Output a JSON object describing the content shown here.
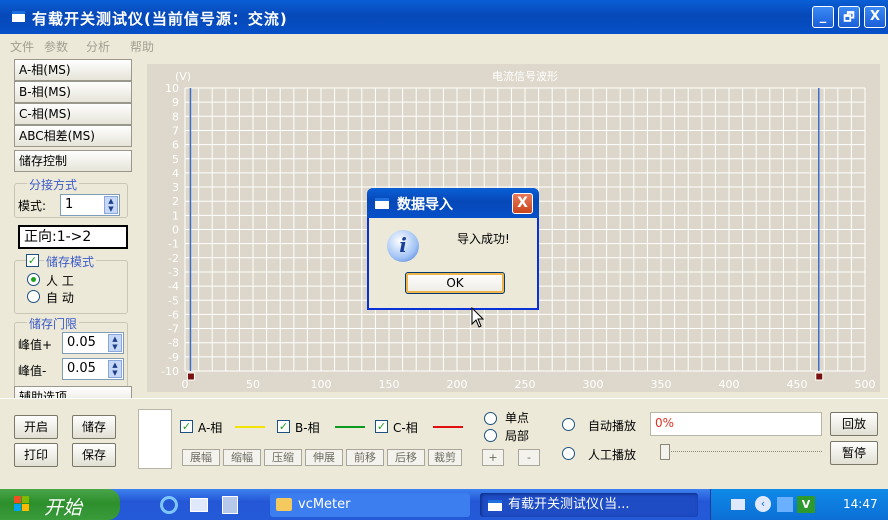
{
  "window": {
    "title": "有载开关测试仪(当前信号源：交流)"
  },
  "titlebar_buttons": {
    "minimize": "_",
    "restore": "🗗",
    "close": "X"
  },
  "menu": [
    "文件",
    "参数",
    "分析",
    "帮助"
  ],
  "sidebar": {
    "nav": [
      "A-相(MS)",
      "B-相(MS)",
      "C-相(MS)",
      "ABC相差(MS)",
      "储存控制"
    ],
    "split_group": {
      "legend": "分接方式",
      "mode_label": "模式:",
      "mode_value": "1",
      "direction": "正向:1->2"
    },
    "store_group": {
      "checkbox_label": "储存模式",
      "checked": true,
      "options": [
        "人 工",
        "自 动"
      ],
      "selected": 0
    },
    "threshold_group": {
      "legend": "储存门限",
      "peak_plus_label": "峰值+",
      "peak_plus_value": "0.05",
      "peak_minus_label": "峰值-",
      "peak_minus_value": "0.05"
    },
    "aux": "辅助选项"
  },
  "actions": {
    "open": "开启",
    "store": "储存",
    "print": "打印",
    "save": "保存"
  },
  "chart_data": {
    "type": "line",
    "title": "电流信号波形",
    "ylabel": "(V)",
    "xlim": [
      0,
      500
    ],
    "ylim": [
      -10,
      10
    ],
    "xticks": [
      "0",
      "50",
      "100",
      "150",
      "200",
      "250",
      "300",
      "350",
      "400",
      "450",
      "500"
    ],
    "yticks": [
      "10",
      "9",
      "8",
      "7",
      "6",
      "5",
      "4",
      "3",
      "2",
      "1",
      "0",
      "-1",
      "-2",
      "-3",
      "-4",
      "-5",
      "-6",
      "-7",
      "-8",
      "-9",
      "-10"
    ],
    "grid": true,
    "cursors": [
      4,
      466
    ]
  },
  "phases": [
    {
      "label": "A-相",
      "checked": true,
      "color": "#f2e300"
    },
    {
      "label": "B-相",
      "checked": true,
      "color": "#0a9a1e"
    },
    {
      "label": "C-相",
      "checked": true,
      "color": "#e01010"
    }
  ],
  "waveform_buttons": [
    "展幅",
    "缩幅",
    "压缩",
    "伸展",
    "前移",
    "后移",
    "裁剪"
  ],
  "view_mode": {
    "options": [
      "单点",
      "局部"
    ],
    "plus": "+",
    "minus": "-"
  },
  "playback": {
    "auto_label": "自动播放",
    "percent": "0%",
    "replay": "回放",
    "manual_label": "人工播放",
    "pause": "暂停"
  },
  "dialog": {
    "title": "数据导入",
    "message": "导入成功!",
    "ok": "OK",
    "close": "X"
  },
  "taskbar": {
    "start": "开始",
    "tasks": [
      "vcMeter",
      "有载开关测试仪(当..."
    ],
    "time": "14:47"
  },
  "colors": {
    "titlebar": "#0a5fd6",
    "grid_line": "#ffffff",
    "plot_bg": "#ddd8cb",
    "cursor": "#3a6fc9",
    "legend_text": "#3c5cc8",
    "percent": "#e03020"
  }
}
